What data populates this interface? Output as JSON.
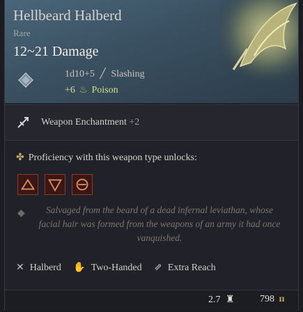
{
  "item": {
    "name": "Hellbeard Halberd",
    "rarity": "Rare",
    "damage": "12~21 Damage",
    "dice": "1d10+5",
    "damage_type": "Slashing",
    "bonus": "+6",
    "bonus_type": "Poison"
  },
  "enchantment": {
    "label": "Weapon Enchantment",
    "value": "+2"
  },
  "proficiency": {
    "title": "Proficiency with this weapon type unlocks:",
    "icon_count": 3
  },
  "description": "Salvaged from the beard of a dead infernal leviathan, whose facial hair was formed from the weapons of an army it had once vanquished.",
  "traits": [
    {
      "label": "Halberd",
      "icon": "halberd-icon"
    },
    {
      "label": "Two-Handed",
      "icon": "two-handed-icon"
    },
    {
      "label": "Extra Reach",
      "icon": "reach-icon"
    }
  ],
  "footer": {
    "weight": "2.7",
    "price": "798"
  },
  "colors": {
    "header": "#3b5263",
    "poison": "#cfe28b",
    "coin": "#c9a64a"
  }
}
